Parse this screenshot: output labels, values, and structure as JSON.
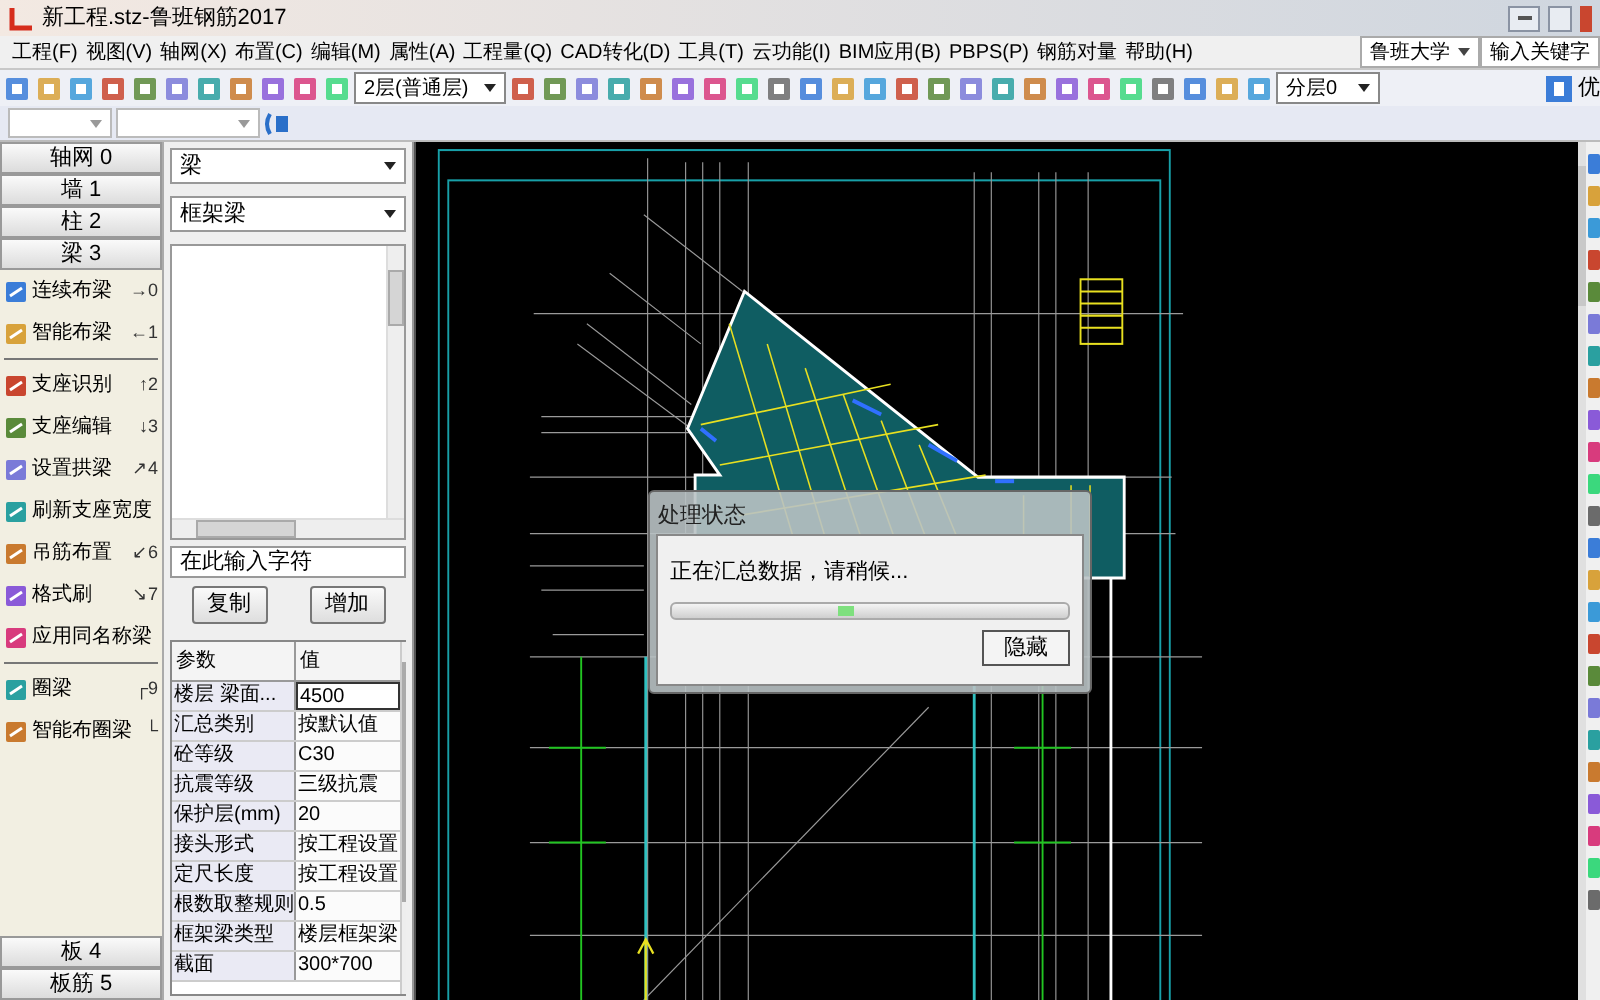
{
  "window": {
    "title": "新工程.stz-鲁班钢筋2017"
  },
  "menu": [
    "工程(F)",
    "视图(V)",
    "轴网(X)",
    "布置(C)",
    "编辑(M)",
    "属性(A)",
    "工程量(Q)",
    "CAD转化(D)",
    "工具(T)",
    "云功能(I)",
    "BIM应用(B)",
    "PBPS(P)",
    "钢筋对量",
    "帮助(H)"
  ],
  "toolbar": {
    "floor_select": "2层(普通层)",
    "layer_select": "分层0",
    "trailing_label": "优"
  },
  "top_right": {
    "site_select": "鲁班大学",
    "search": {
      "placeholder": "输入关键字"
    }
  },
  "left_nav": {
    "categories": [
      "轴网 0",
      "墙 1",
      "柱 2",
      "梁 3"
    ],
    "tool_groups": [
      [
        {
          "label": "连续布梁",
          "shortcut": "→0"
        },
        {
          "label": "智能布梁",
          "shortcut": "←1"
        }
      ],
      [
        {
          "label": "支座识别",
          "shortcut": "↑2"
        },
        {
          "label": "支座编辑",
          "shortcut": "↓3"
        },
        {
          "label": "设置拱梁",
          "shortcut": "↗4"
        },
        {
          "label": "刷新支座宽度"
        },
        {
          "label": "吊筋布置",
          "shortcut": "↙6"
        },
        {
          "label": "格式刷",
          "shortcut": "↘7"
        },
        {
          "label": "应用同名称梁"
        }
      ],
      [
        {
          "label": "圈梁",
          "shortcut": "┌9"
        },
        {
          "label": "智能布圈梁",
          "shortcut": "└"
        }
      ]
    ],
    "bottom_categories": [
      "板 4",
      "板筋 5"
    ]
  },
  "component_panel": {
    "type_select": "梁",
    "subtype_select": "框架梁",
    "filter_input": {
      "placeholder": "在此输入字符"
    },
    "buttons": [
      "复制",
      "增加"
    ],
    "properties": {
      "columns": [
        "参数",
        "值"
      ],
      "rows": [
        {
          "name": "楼层 梁面...",
          "value": "4500",
          "selected": true
        },
        {
          "name": "汇总类别",
          "value": "按默认值",
          "selected": false
        },
        {
          "name": "砼等级",
          "value": "C30",
          "selected": false
        },
        {
          "name": "抗震等级",
          "value": "三级抗震",
          "selected": false
        },
        {
          "name": "保护层(mm)",
          "value": "20",
          "selected": false
        },
        {
          "name": "接头形式",
          "value": "按工程设置",
          "selected": false
        },
        {
          "name": "定尺长度",
          "value": "按工程设置",
          "selected": false
        },
        {
          "name": "根数取整规则",
          "value": "0.5",
          "selected": false
        },
        {
          "name": "框架梁类型",
          "value": "楼层框架梁",
          "selected": false
        },
        {
          "name": "截面",
          "value": "300*700",
          "selected": false
        }
      ]
    }
  },
  "dialog": {
    "title": "处理状态",
    "message": "正在汇总数据，请稍候...",
    "progress": {
      "level": 0.42
    },
    "button": "隐藏"
  }
}
